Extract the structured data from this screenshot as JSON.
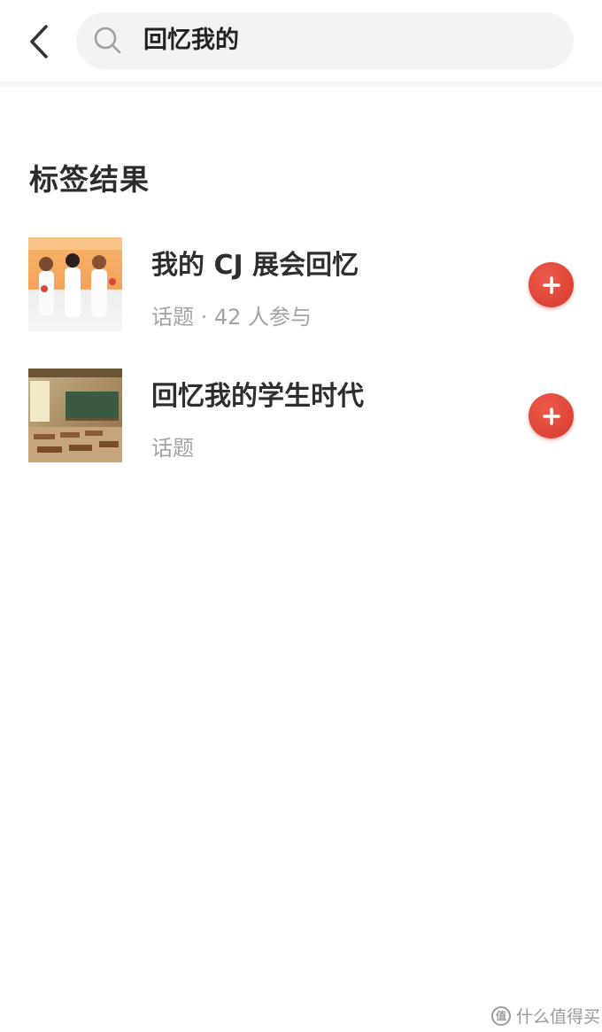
{
  "header": {
    "back_icon": "chevron-left-icon",
    "search": {
      "icon": "search-icon",
      "value": "回忆我的"
    }
  },
  "section": {
    "title": "标签结果"
  },
  "results": [
    {
      "title": "我的 CJ 展会回忆",
      "subtitle": "话题 · 42 人参与",
      "thumbnail": "cj-expo-photo",
      "action_icon": "plus-icon"
    },
    {
      "title": "回忆我的学生时代",
      "subtitle": "话题",
      "thumbnail": "classroom-photo",
      "action_icon": "plus-icon"
    }
  ],
  "watermark": {
    "text": "什么值得买",
    "logo": "值"
  },
  "colors": {
    "accent": "#e04a3c",
    "title_text": "#2e2e2e",
    "sub_text": "#a3a3a3",
    "search_bg": "#f3f3f3"
  }
}
